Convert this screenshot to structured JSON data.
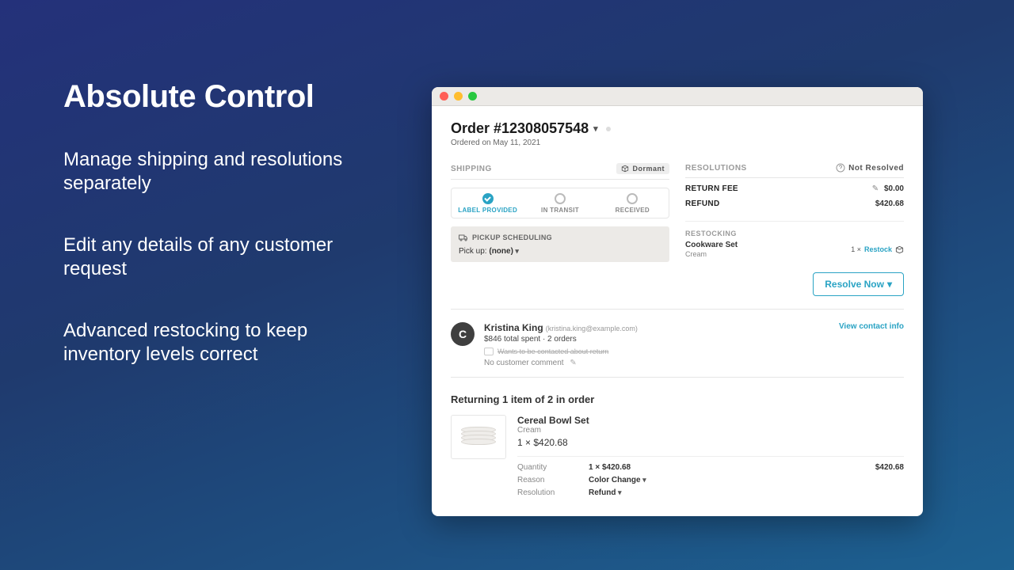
{
  "marketing": {
    "title": "Absolute Control",
    "bullet1": "Manage shipping and resolutions separately",
    "bullet2": "Edit any details of any customer request",
    "bullet3": "Advanced restocking to keep inventory levels correct"
  },
  "order": {
    "title": "Order #12308057548",
    "ordered_on": "Ordered on May 11, 2021"
  },
  "shipping": {
    "header": "SHIPPING",
    "status_badge": "Dormant",
    "steps": {
      "s1": "LABEL PROVIDED",
      "s2": "IN TRANSIT",
      "s3": "RECEIVED"
    },
    "pickup_header": "PICKUP SCHEDULING",
    "pickup_label": "Pick up:",
    "pickup_value": "(none)"
  },
  "resolutions": {
    "header": "RESOLUTIONS",
    "status": "Not Resolved",
    "return_fee_label": "RETURN FEE",
    "return_fee_value": "$0.00",
    "refund_label": "REFUND",
    "refund_value": "$420.68",
    "restocking_header": "RESTOCKING",
    "restock_item": "Cookware Set",
    "restock_variant": "Cream",
    "restock_qty": "1 ×",
    "restock_action": "Restock",
    "resolve_button": "Resolve Now"
  },
  "customer": {
    "initial": "C",
    "name": "Kristina King",
    "email": "(kristina.king@example.com)",
    "stats": "$846 total spent  ·  2 orders",
    "flag": "Wants to be contacted about return",
    "no_comment": "No customer comment",
    "view_contact": "View contact info"
  },
  "returning_header": "Returning 1 item of 2 in order",
  "item": {
    "name": "Cereal Bowl Set",
    "variant": "Cream",
    "price_line": "1 × $420.68",
    "qty_label": "Quantity",
    "qty_value": "1 × $420.68",
    "reason_label": "Reason",
    "reason_value": "Color Change",
    "resolution_label": "Resolution",
    "resolution_value": "Refund",
    "line_total": "$420.68"
  }
}
